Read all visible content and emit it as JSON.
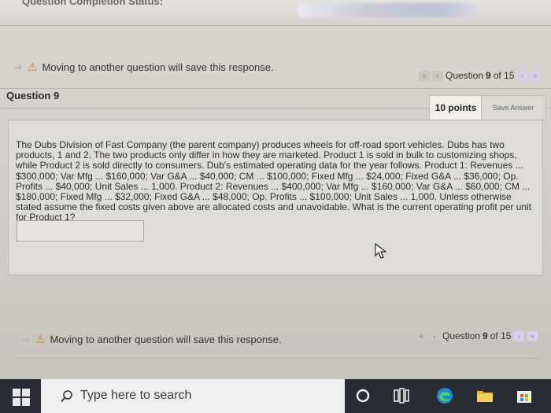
{
  "header": {
    "completion_label": "Question Completion Status:"
  },
  "top_nav": {
    "warning_text": "Moving to another question will save this response.",
    "question_label": "Question",
    "question_number": "9",
    "of_label": "of 15"
  },
  "question": {
    "title": "Question 9",
    "points": "10 points",
    "save_button": "Save Answer",
    "text": "The Dubs Division of Fast Company (the parent company) produces wheels for off-road sport vehicles. Dubs has two products, 1 and 2. The two products only differ in how they are marketed. Product 1 is sold in bulk to customizing shops, while Product 2 is sold directly to consumers. Dub's estimated operating data for the year follows. Product 1: Revenues ... $300,000; Var Mfg ... $160,000; Var G&A ... $40,000; CM ... $100,000; Fixed Mfg ... $24,000; Fixed G&A ... $36,000; Op. Profits ... $40,000; Unit Sales ... 1,000. Product 2: Revenues ... $400,000; Var Mfg ... $160,000; Var G&A ... $60,000; CM ... $180,000; Fixed Mfg ... $32,000; Fixed G&A ... $48,000; Op. Profits ... $100,000; Unit Sales ... 1,000. Unless otherwise stated assume the fixed costs given above are allocated costs and unavoidable. What is the current operating profit per unit for Product 1?",
    "answer_value": ""
  },
  "bottom_nav": {
    "warning_text": "Moving to another question will save this response.",
    "question_label": "Question",
    "question_number": "9",
    "of_label": "of 15"
  },
  "taskbar": {
    "search_placeholder": "Type here to search"
  },
  "colors": {
    "warning": "#cc8a00",
    "nav_active": "#9a88c0",
    "taskbar": "#2a2c33"
  }
}
